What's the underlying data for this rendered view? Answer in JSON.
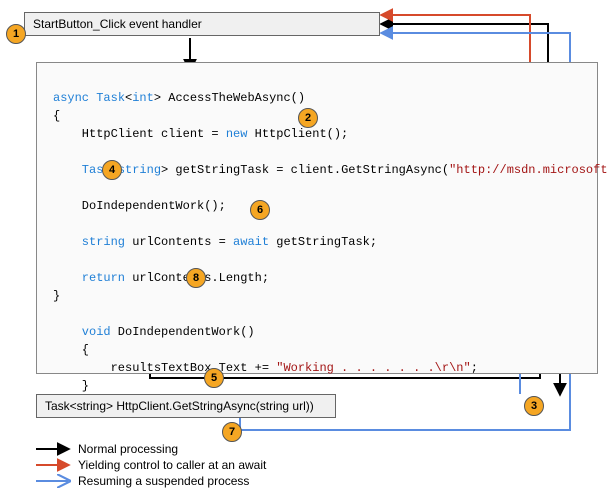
{
  "boxes": {
    "start_handler": "StartButton_Click event handler",
    "get_string_async": "Task<string> HttpClient.GetStringAsync(string url))"
  },
  "code": {
    "sig_async": "async",
    "sig_task": "Task",
    "sig_int": "int",
    "sig_name": "AccessTheWebAsync()",
    "sig_open": "{",
    "l_client_1": "    HttpClient client = ",
    "l_client_new": "new",
    "l_client_2": " HttpClient();",
    "l_task": "    Task",
    "l_task_type": "string",
    "l_task_rest": " getStringTask = client.GetStringAsync(",
    "l_url": "\"http://msdn.microsoft.com\"",
    "l_task_end": ");",
    "l_dowork": "    DoIndependentWork();",
    "l_uc_1": "    string",
    "l_uc_2": " urlContents = ",
    "l_uc_await": "await",
    "l_uc_3": " getStringTask;",
    "l_ret": "    return",
    "l_ret2": " urlContents.Length;",
    "close": "}",
    "d_sig": "    void",
    "d_name": " DoIndependentWork()",
    "d_open": "    {",
    "d_body1": "        resultsTextBox.Text += ",
    "d_body_str": "\"Working . . . . . . .\\r\\n\"",
    "d_body2": ";",
    "d_close": "    }"
  },
  "badges": {
    "b1": "1",
    "b2": "2",
    "b3": "3",
    "b4": "4",
    "b5": "5",
    "b6": "6",
    "b7": "7",
    "b8": "8"
  },
  "legend": {
    "normal": "Normal processing",
    "yield": "Yielding control to caller at an await",
    "resume": "Resuming a suspended process"
  },
  "colors": {
    "normal": "#000",
    "yield": "#d64a2b",
    "resume": "#5a8ce0"
  }
}
